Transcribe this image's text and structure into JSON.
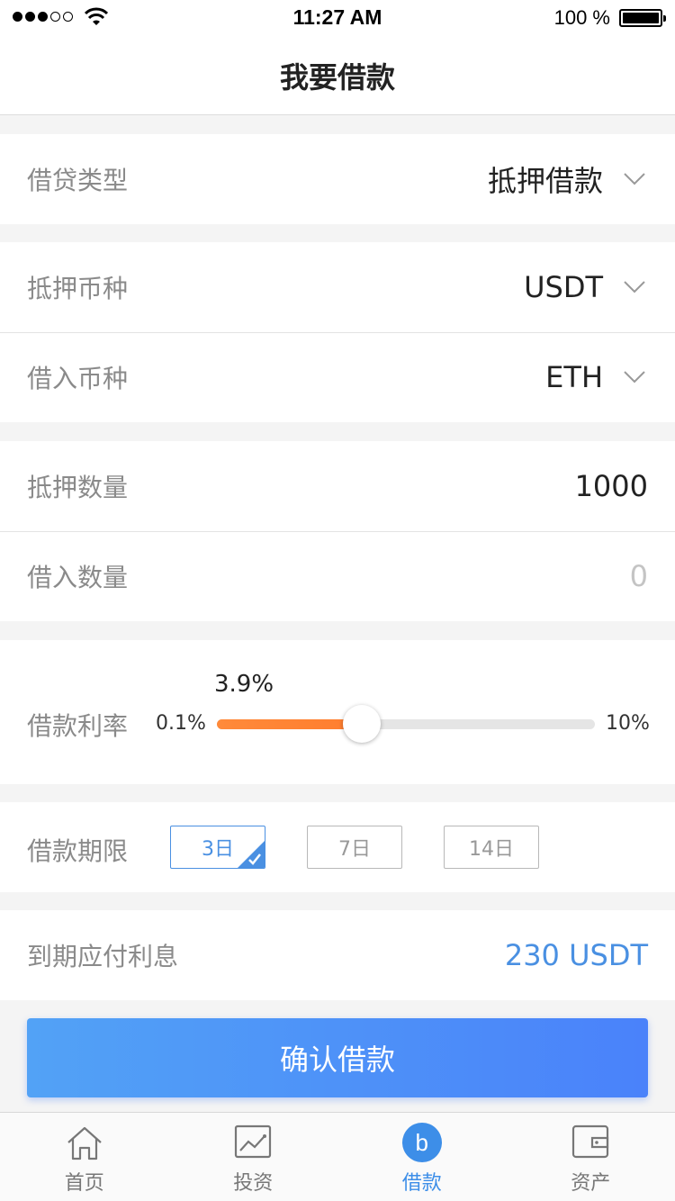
{
  "status_bar": {
    "time": "11:27 AM",
    "battery": "100 %",
    "signal_dots_filled": 3,
    "signal_dots_total": 5
  },
  "header": {
    "title": "我要借款"
  },
  "form": {
    "loan_type": {
      "label": "借贷类型",
      "value": "抵押借款"
    },
    "collateral_currency": {
      "label": "抵押币种",
      "value": "USDT"
    },
    "borrow_currency": {
      "label": "借入币种",
      "value": "ETH"
    },
    "collateral_amount": {
      "label": "抵押数量",
      "value": "1000"
    },
    "borrow_amount": {
      "label": "借入数量",
      "placeholder": "0"
    },
    "interest_rate": {
      "label": "借款利率",
      "current": "3.9%",
      "min_label": "0.1%",
      "max_label": "10%",
      "min": 0.1,
      "max": 10,
      "value": 3.9
    },
    "term": {
      "label": "借款期限",
      "options": [
        "3日",
        "7日",
        "14日"
      ],
      "selected_index": 0
    },
    "interest_due": {
      "label": "到期应付利息",
      "value": "230 USDT"
    }
  },
  "confirm_button": {
    "label": "确认借款"
  },
  "tab_bar": {
    "tabs": [
      {
        "label": "首页",
        "icon": "home-icon"
      },
      {
        "label": "投资",
        "icon": "chart-icon"
      },
      {
        "label": "借款",
        "icon": "borrow-badge-icon",
        "badge": "b"
      },
      {
        "label": "资产",
        "icon": "wallet-icon"
      }
    ],
    "active_index": 2
  },
  "colors": {
    "accent": "#4a90e2",
    "slider_fill": "#ff8a3a",
    "button_gradient_start": "#52a2f6",
    "button_gradient_end": "#4a82fa"
  }
}
